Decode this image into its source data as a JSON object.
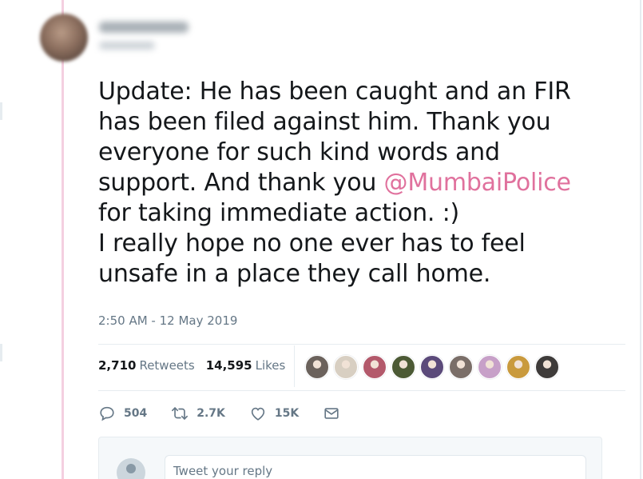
{
  "tweet": {
    "text_lines": [
      "Update: He has been caught and an FIR",
      "has been filed against him. Thank you",
      "everyone for such kind words and",
      "support. And thank you ",
      "@MumbaiPolice",
      "for taking immediate action. :)",
      "I really hope no one ever has to feel",
      "unsafe in a place they call home."
    ],
    "timestamp": "2:50 AM - 12 May 2019"
  },
  "stats": {
    "retweets_count": "2,710",
    "retweets_label": "Retweets",
    "likes_count": "14,595",
    "likes_label": "Likes"
  },
  "actions": {
    "reply_count": "504",
    "retweet_count": "2.7K",
    "like_count": "15K"
  },
  "reply": {
    "placeholder": "Tweet your reply"
  },
  "colors": {
    "mention": "#e0719d",
    "thread_line": "#f4cfe0",
    "muted_text": "#657786"
  },
  "likers": [
    {
      "icon": "liker-avatar-1",
      "color": "#6b625c"
    },
    {
      "icon": "liker-avatar-2",
      "color": "#d8cfc2"
    },
    {
      "icon": "liker-avatar-3",
      "color": "#b3596b"
    },
    {
      "icon": "liker-avatar-4",
      "color": "#4c5a35"
    },
    {
      "icon": "liker-avatar-5",
      "color": "#5b4a7a"
    },
    {
      "icon": "liker-avatar-6",
      "color": "#7a6e68"
    },
    {
      "icon": "liker-avatar-7",
      "color": "#c7a0c8"
    },
    {
      "icon": "liker-avatar-8",
      "color": "#c99a3d"
    },
    {
      "icon": "liker-avatar-9",
      "color": "#3e3b3a"
    }
  ]
}
